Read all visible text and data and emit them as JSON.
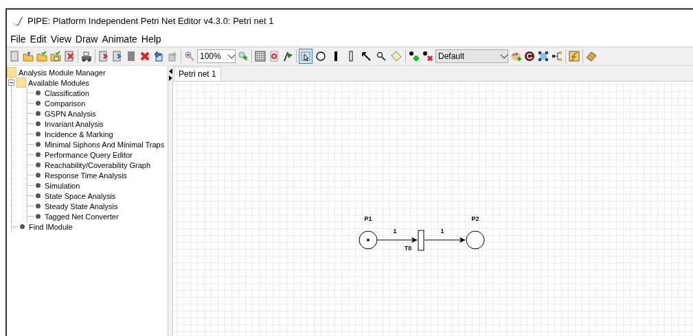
{
  "window": {
    "title": "PIPE: Platform Independent Petri Net Editor v4.3.0: Petri net 1"
  },
  "menu": [
    "File",
    "Edit",
    "View",
    "Draw",
    "Animate",
    "Help"
  ],
  "toolbar": {
    "zoom": "100%",
    "token_class": "Default",
    "draw_modes": [
      {
        "selected": true
      },
      {
        "selected": false
      },
      {
        "selected": false
      },
      {
        "selected": false
      },
      {
        "selected": false
      },
      {
        "selected": false
      },
      {
        "selected": false
      }
    ]
  },
  "module_tree": {
    "label": "Analysis Module Manager",
    "children": [
      {
        "label": "Available Modules",
        "expanded": true,
        "children": [
          {
            "label": "Classification"
          },
          {
            "label": "Comparison"
          },
          {
            "label": "GSPN Analysis"
          },
          {
            "label": "Invariant Analysis"
          },
          {
            "label": "Incidence & Marking"
          },
          {
            "label": "Minimal Siphons And Minimal Traps"
          },
          {
            "label": "Performance Query Editor"
          },
          {
            "label": "Reachability/Coverability Graph"
          },
          {
            "label": "Response Time Analysis"
          },
          {
            "label": "Simulation"
          },
          {
            "label": "State Space Analysis"
          },
          {
            "label": "Steady State Analysis"
          },
          {
            "label": "Tagged Net Converter"
          }
        ]
      },
      {
        "label": "Find IModule"
      }
    ]
  },
  "tabs": [
    {
      "label": "Petri net 1",
      "selected": true
    }
  ],
  "net": {
    "places": [
      {
        "label": "P1",
        "marked": true
      },
      {
        "label": "P2",
        "marked": false
      }
    ],
    "transitions": [
      {
        "label": "T0",
        "kind": "timed"
      }
    ],
    "arcs": [
      {
        "weight": "1"
      },
      {
        "weight": "1"
      }
    ]
  }
}
